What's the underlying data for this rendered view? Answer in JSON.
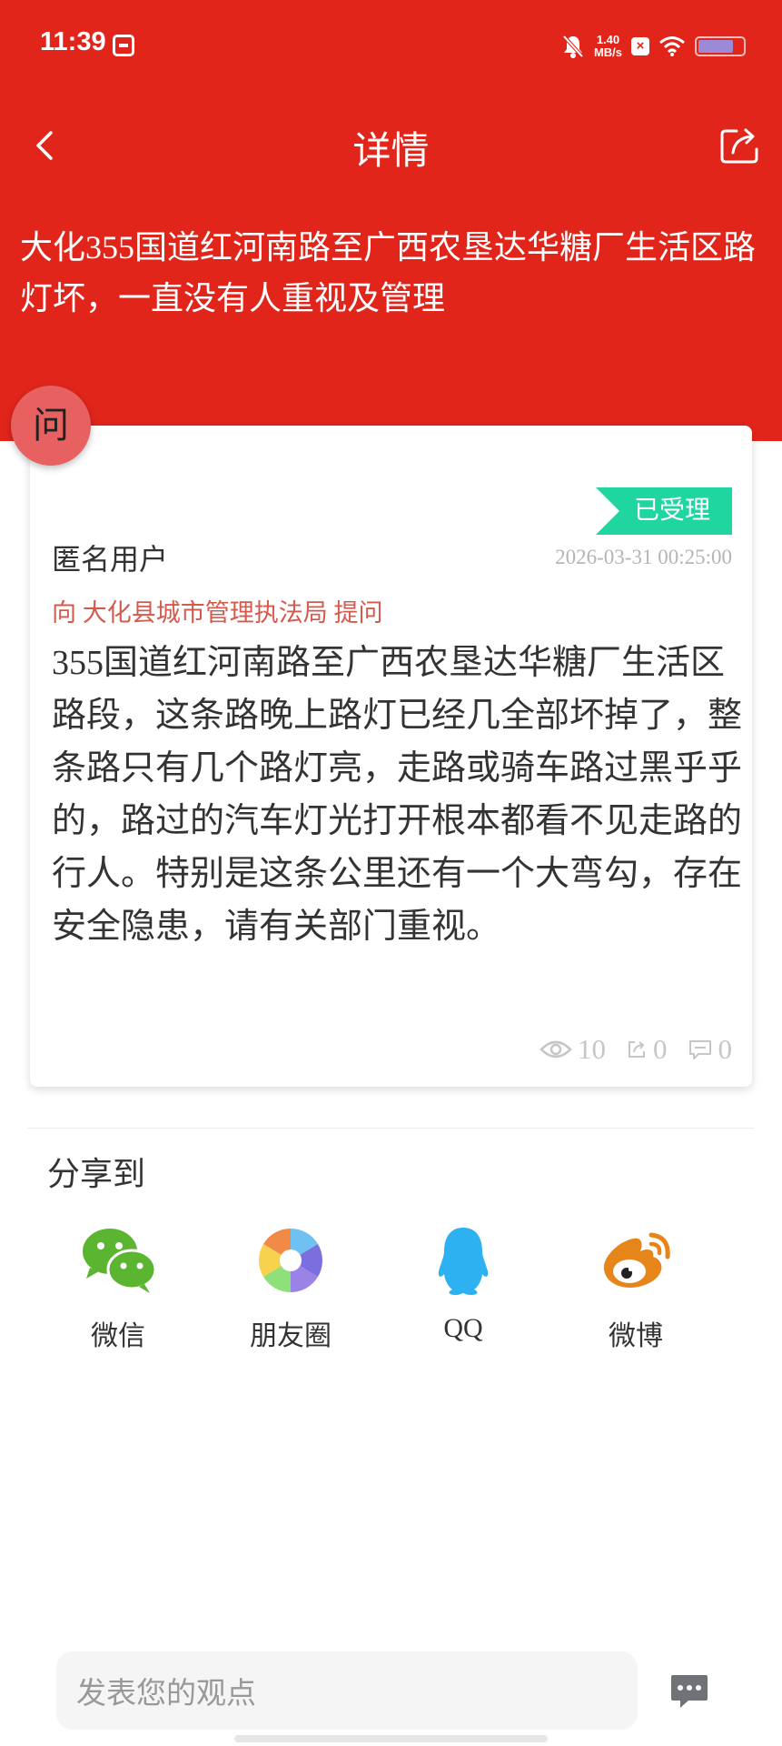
{
  "status_bar": {
    "time": "11:39",
    "speed_value": "1.40",
    "speed_unit": "MB/s",
    "x_badge": "×"
  },
  "nav": {
    "title": "详情"
  },
  "question": {
    "title": "大化355国道红河南路至广西农垦达华糖厂生活区路灯坏，一直没有人重视及管理",
    "badge": "问",
    "status": "已受理",
    "author": "匿名用户",
    "time": "2026-03-31 00:25:00",
    "addressee": "向 大化县城市管理执法局 提问",
    "content": "355国道红河南路至广西农垦达华糖厂生活区路段，这条路晚上路灯已经几全部坏掉了，整条路只有几个路灯亮，走路或骑车路过黑乎乎的，路过的汽车灯光打开根本都看不见走路的行人。特别是这条公里还有一个大弯勾，存在安全隐患，请有关部门重视。",
    "views": "10",
    "shares": "0",
    "comments": "0"
  },
  "share": {
    "label": "分享到",
    "items": [
      {
        "label": "微信",
        "icon": "wechat-icon"
      },
      {
        "label": "朋友圈",
        "icon": "moments-icon"
      },
      {
        "label": "QQ",
        "icon": "qq-icon"
      },
      {
        "label": "微博",
        "icon": "weibo-icon"
      }
    ]
  },
  "comment": {
    "placeholder": "发表您的观点"
  },
  "colors": {
    "header_red": "#E1251B",
    "status_green": "#1FD6A0",
    "addressee_red": "#D45A4E"
  }
}
